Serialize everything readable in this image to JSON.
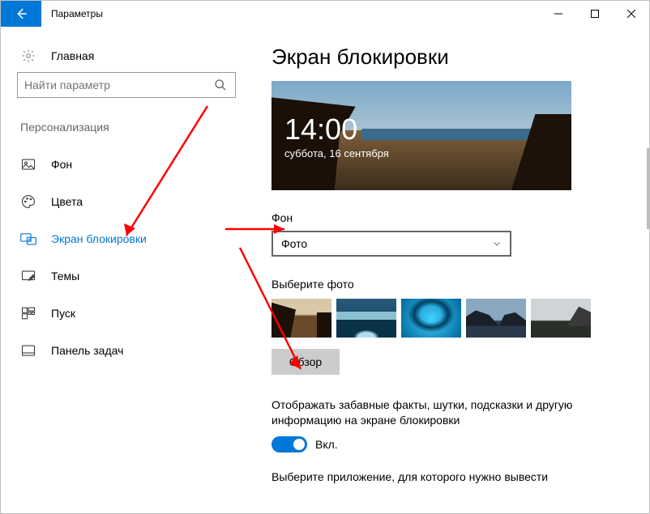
{
  "window": {
    "title": "Параметры"
  },
  "sidebar": {
    "home": "Главная",
    "search_placeholder": "Найти параметр",
    "section": "Персонализация",
    "items": [
      {
        "label": "Фон"
      },
      {
        "label": "Цвета"
      },
      {
        "label": "Экран блокировки"
      },
      {
        "label": "Темы"
      },
      {
        "label": "Пуск"
      },
      {
        "label": "Панель задач"
      }
    ]
  },
  "main": {
    "heading": "Экран блокировки",
    "preview": {
      "time": "14:00",
      "date": "суббота, 16 сентября"
    },
    "bg_label": "Фон",
    "bg_value": "Фото",
    "choose_label": "Выберите фото",
    "browse": "Обзор",
    "fun_facts": "Отображать забавные факты, шутки, подсказки и другую информацию на экране блокировки",
    "toggle_label": "Вкл.",
    "bottom_text": "Выберите приложение, для которого нужно вывести"
  }
}
